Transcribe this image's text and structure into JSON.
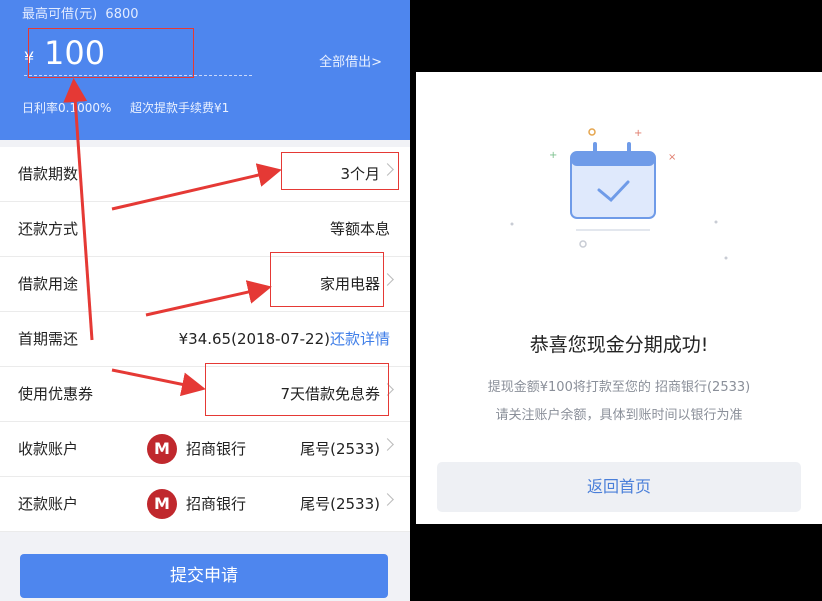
{
  "loan_form": {
    "max_label": "最高可借(元)",
    "max_value": "6800",
    "currency": "¥",
    "amount": "100",
    "borrow_all": "全部借出>",
    "daily_rate": "日利率0.1000%",
    "first_fee": "超次提款手续费¥1",
    "rows": [
      {
        "label": "借款期数",
        "value": "3个月"
      },
      {
        "label": "还款方式",
        "value": "等额本息"
      },
      {
        "label": "借款用途",
        "value": "家用电器"
      },
      {
        "label": "首期需还",
        "value": "¥34.65(2018-07-22)",
        "link": "还款详情"
      },
      {
        "label": "使用优惠券",
        "value": "7天借款免息券"
      },
      {
        "label": "收款账户",
        "bank": "招商银行",
        "tail": "尾号(2533)"
      },
      {
        "label": "还款账户",
        "bank": "招商银行",
        "tail": "尾号(2533)"
      }
    ],
    "submit": "提交申请"
  },
  "success": {
    "title": "恭喜您现金分期成功!",
    "line1": "提现金额¥100将打款至您的 招商银行(2533)",
    "line2": "请关注账户余额，具体到账时间以银行为准",
    "home_button": "返回首页"
  },
  "colors": {
    "primary": "#4e86ee",
    "annotation_red": "#e53935",
    "bank_red": "#c0282d",
    "link": "#3f7ee8"
  }
}
